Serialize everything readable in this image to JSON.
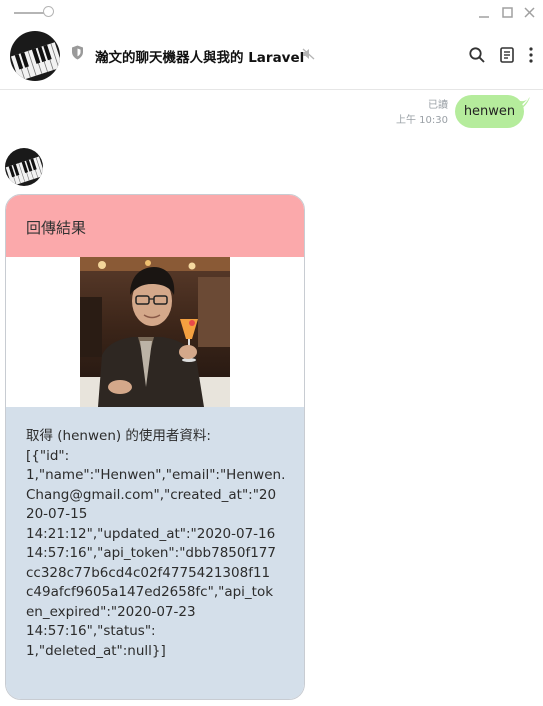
{
  "window": {
    "pin_icon": "pin-slider-icon",
    "controls": [
      "minimize-icon",
      "maximize-icon",
      "close-icon"
    ]
  },
  "header": {
    "title": "瀚文的聊天機器人與我的 Laravel",
    "icons": [
      "shield-icon",
      "mute-icon",
      "search-icon",
      "notes-icon",
      "more-icon"
    ]
  },
  "sent_message": {
    "read_status": "已讀",
    "time": "上午 10:30",
    "text": "henwen",
    "bubble_color": "#b5ec9c"
  },
  "card": {
    "header_text": "回傳結果",
    "header_color": "#fba9ab",
    "body_color": "#d4dfea",
    "body_text": "取得 (henwen) 的使用者資料:\n[{\"id\":\n1,\"name\":\"Henwen\",\"email\":\"Henwen.\nChang@gmail.com\",\"created_at\":\"20\n20-07-15\n14:21:12\",\"updated_at\":\"2020-07-16\n14:57:16\",\"api_token\":\"dbb7850f177\ncc328c77b6cd4c02f4775421308f11\nc49afcf9605a147ed2658fc\",\"api_tok\nen_expired\":\"2020-07-23\n14:57:16\",\"status\":\n1,\"deleted_at\":null}]"
  }
}
